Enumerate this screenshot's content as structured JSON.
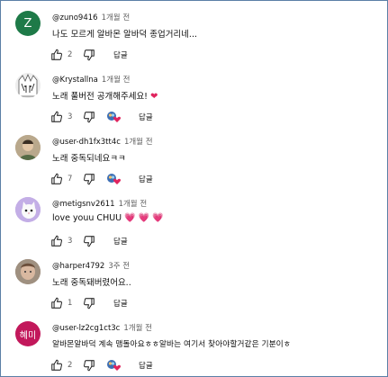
{
  "colors": {
    "border": "#5b7fa6",
    "heart": "#e0245e",
    "meta": "#606060"
  },
  "reply_label": "답글",
  "comments": [
    {
      "author": "@zuno9416",
      "time": "1개월 전",
      "text": "나도 모르게 알바몬 알바덕 종업거리네...",
      "likes": "2",
      "hearted": false,
      "avatar": {
        "letter": "Z",
        "color": "#1e7a48"
      }
    },
    {
      "author": "@Krystallna",
      "time": "1개월 전",
      "text": "노래 풀버전 공개해주세요!",
      "text_emoji": "❤",
      "likes": "3",
      "hearted": true,
      "avatar": {
        "type": "anime"
      }
    },
    {
      "author": "@user-dh1fx3tt4c",
      "time": "1개월 전",
      "text": "노래 중독되네요ㅋㅋ",
      "likes": "7",
      "hearted": true,
      "avatar": {
        "type": "photo"
      }
    },
    {
      "author": "@metigsnv2611",
      "time": "1개월 전",
      "text": "love youu CHUU",
      "text_emoji": "💗 💗 💗",
      "likes": "3",
      "hearted": false,
      "avatar": {
        "type": "cat"
      }
    },
    {
      "author": "@harper4792",
      "time": "3주 전",
      "text": "노래 중독돼버렸어요..",
      "likes": "1",
      "hearted": false,
      "avatar": {
        "type": "face"
      }
    },
    {
      "author": "@user-lz2cg1ct3c",
      "time": "1개월 전",
      "text": "알바몬알바덕 계속 맴돌아요ㅎㅎ알바는 여기서 찾아야할거같은 기분이ㅎ",
      "likes": "2",
      "hearted": true,
      "avatar": {
        "letter": "혜미",
        "color": "#c2185b"
      }
    }
  ]
}
